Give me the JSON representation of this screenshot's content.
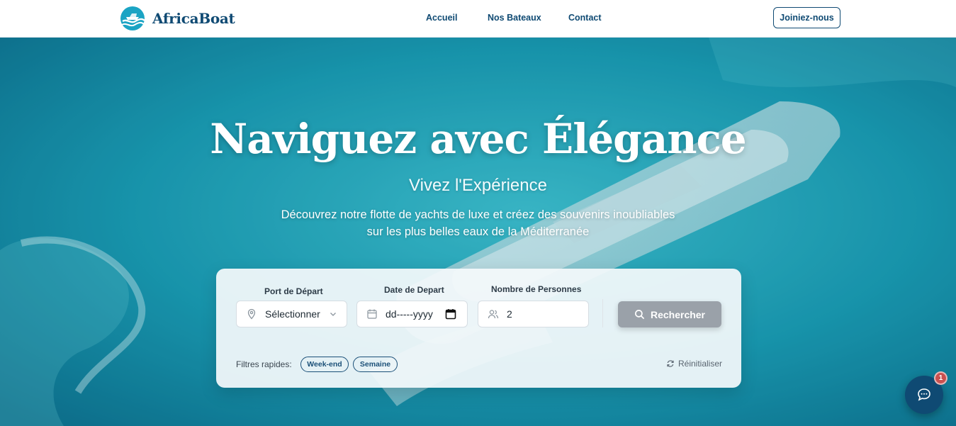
{
  "brand": {
    "name": "AfricaBoat",
    "logo_icon": "boat-wave-logo"
  },
  "nav": {
    "items": [
      "Accueil",
      "Nos Bateaux",
      "Contact"
    ],
    "cta": "Joiniez-nous"
  },
  "hero": {
    "title": "Naviguez avec Élégance",
    "subtitle": "Vivez l'Expérience",
    "description_line1": "Découvrez notre flotte de yachts de luxe et créez des souvenirs inoubliables",
    "description_line2": "sur les plus belles eaux de la Méditerranée"
  },
  "search": {
    "port": {
      "label": "Port de Départ",
      "value": "Sélectionner u",
      "icon": "location-pin-icon"
    },
    "date": {
      "label": "Date de Depart",
      "placeholder": "dd-----yyyy",
      "icon": "calendar-icon"
    },
    "persons": {
      "label": "Nombre de Personnes",
      "value": "2",
      "icon": "users-icon"
    },
    "button": "Rechercher",
    "quick_filters_label": "Filtres rapides:",
    "quick_filters": [
      "Week-end",
      "Semaine"
    ],
    "reset": "Réinitialiser"
  },
  "chat": {
    "badge": "1",
    "icon": "chat-bubble-icon"
  },
  "colors": {
    "primary": "#0f4a73",
    "sea": "#1b9db0",
    "button_disabled": "#9aa1a9",
    "badge": "#c9504f"
  }
}
